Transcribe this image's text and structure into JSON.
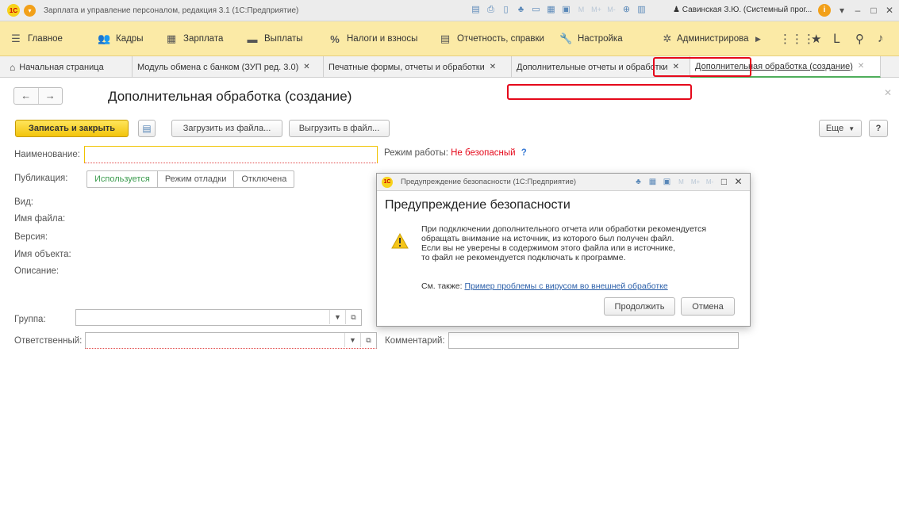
{
  "window": {
    "title": "Зарплата и управление персоналом, редакция 3.1  (1С:Предприятие)",
    "user": "Савинская З.Ю. (Системный прог...",
    "logo_text": "1С"
  },
  "main_menu": [
    {
      "label": "Главное",
      "icon": "hamburger-icon"
    },
    {
      "label": "Кадры",
      "icon": "people-icon"
    },
    {
      "label": "Зарплата",
      "icon": "calculator-icon"
    },
    {
      "label": "Выплаты",
      "icon": "money-icon"
    },
    {
      "label": "Налоги и взносы",
      "icon": "percent-icon"
    },
    {
      "label": "Отчетность, справки",
      "icon": "report-icon"
    },
    {
      "label": "Настройка",
      "icon": "wrench-icon"
    },
    {
      "label": "Администрирова",
      "icon": "gear-icon"
    }
  ],
  "tabs": [
    {
      "label": "Начальная страница"
    },
    {
      "label": "Модуль обмена с банком (ЗУП ред. 3.0)"
    },
    {
      "label": "Печатные формы, отчеты и обработки"
    },
    {
      "label": "Дополнительные отчеты и обработки"
    },
    {
      "label": "Дополнительная обработка (создание)"
    }
  ],
  "form": {
    "title": "Дополнительная обработка (создание)",
    "save_close": "Записать и закрыть",
    "load_file": "Загрузить из файла...",
    "export_file": "Выгрузить в файл...",
    "more": "Еще",
    "help": "?",
    "name_label": "Наименование:",
    "mode_label": "Режим работы:",
    "mode_value": "Не безопасный",
    "mode_help": "?",
    "publication_label": "Публикация:",
    "publication_options": [
      "Используется",
      "Режим отладки",
      "Отключена"
    ],
    "publication_selected": "Используется",
    "kind_label": "Вид:",
    "file_label": "Имя файла:",
    "version_label": "Версия:",
    "object_label": "Имя объекта:",
    "description_label": "Описание:",
    "group_label": "Группа:",
    "responsible_label": "Ответственный:",
    "comment_label": "Комментарий:"
  },
  "dialog": {
    "title": "Предупреждение безопасности (1С:Предприятие)",
    "heading": "Предупреждение безопасности",
    "logo_text": "1С",
    "lines": [
      "При подключении дополнительного отчета или обработки рекомендуется",
      "обращать внимание на источник, из которого был получен файл.",
      "Если вы не уверены в содержимом этого файла или в источнике,",
      "то файл не рекомендуется подключать к программе."
    ],
    "see_also": "См. также:",
    "link": "Пример проблемы с вирусом во внешней обработке",
    "continue": "Продолжить",
    "cancel": "Отмена"
  },
  "colors": {
    "menu_bg": "#fbeaa6",
    "primary_button": "#f2c40c",
    "highlight": "#e5091b",
    "active_tab_underline": "#4fae5b"
  }
}
